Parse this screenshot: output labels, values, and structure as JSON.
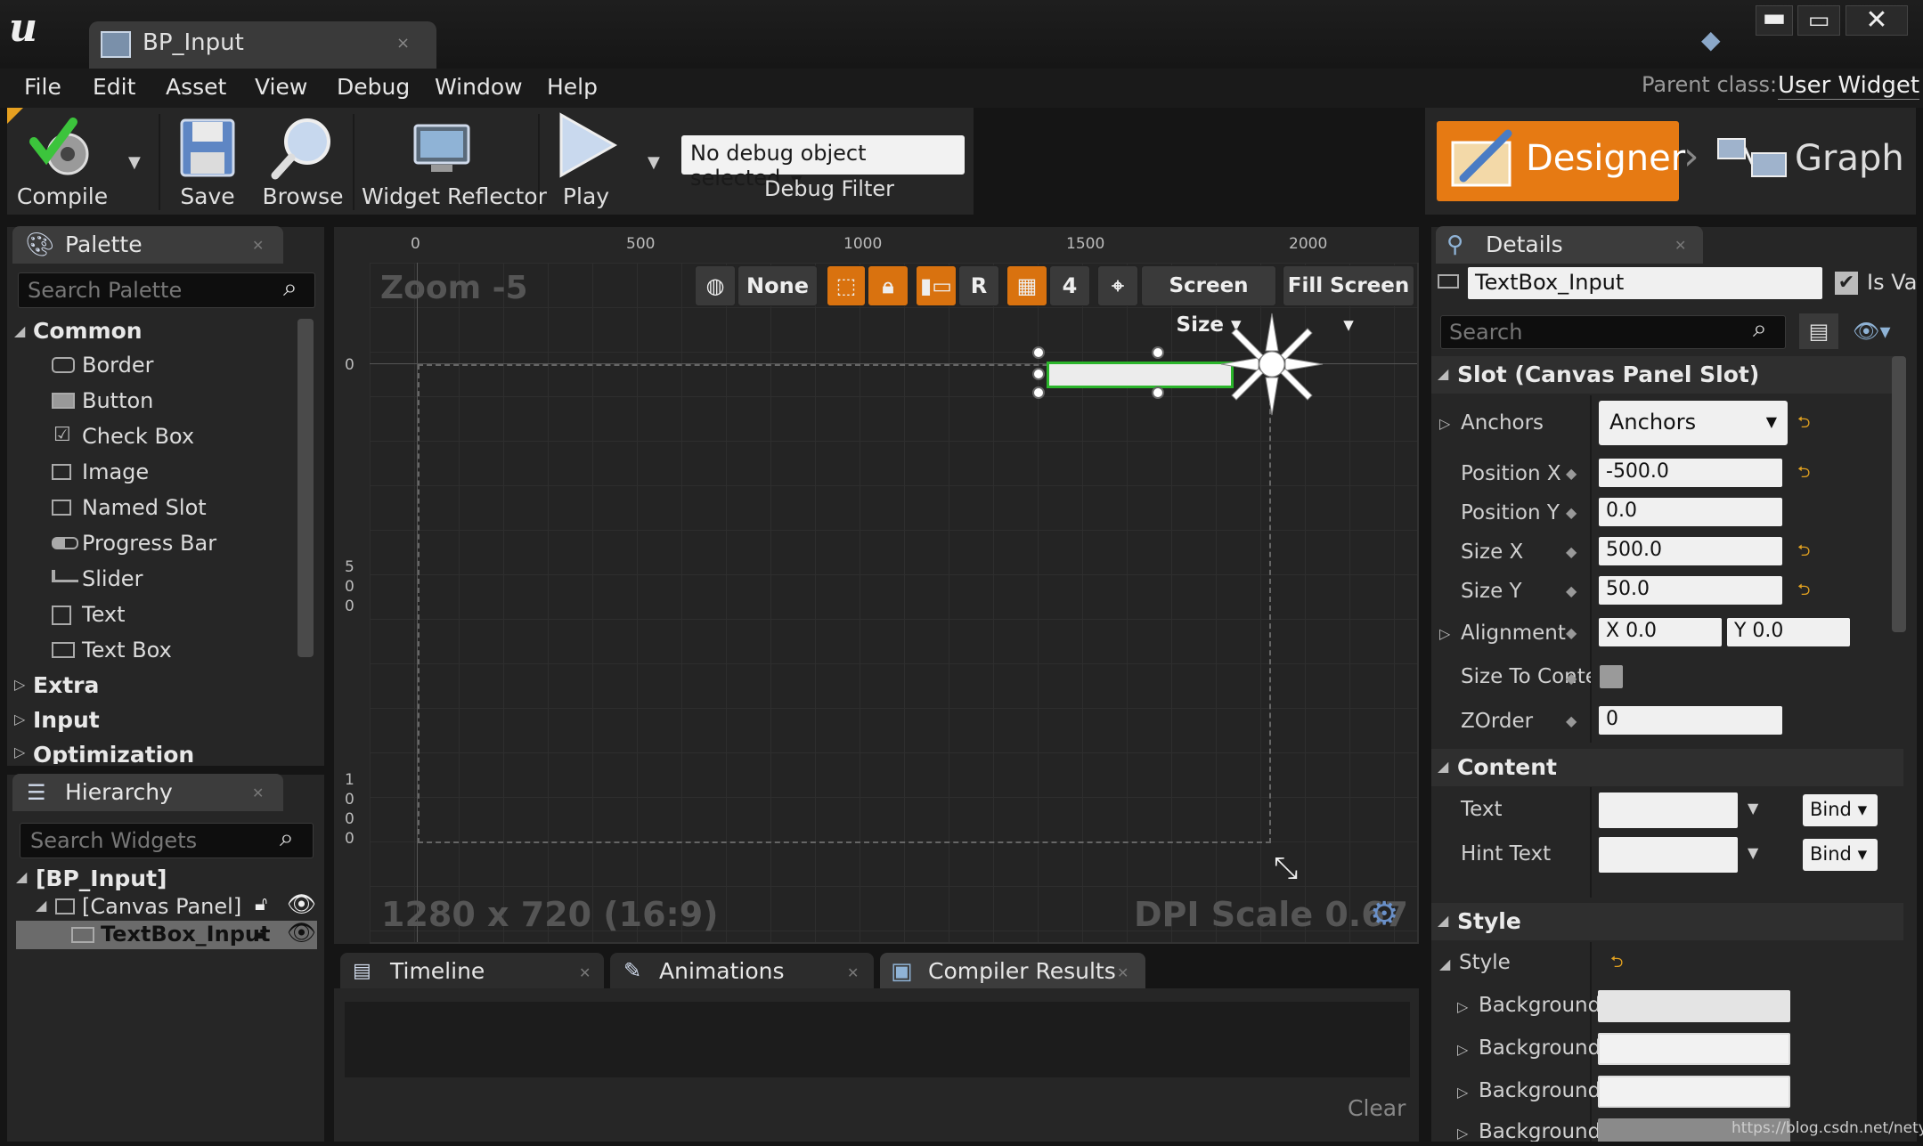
{
  "window": {
    "tab_title": "BP_Input",
    "tab_close": "×",
    "minimize": "▬",
    "maximize": "▭",
    "close": "✕"
  },
  "menu": {
    "items": [
      "File",
      "Edit",
      "Asset",
      "View",
      "Debug",
      "Window",
      "Help"
    ],
    "parent_class_label": "Parent class:",
    "parent_class_value": "User Widget"
  },
  "toolbar": {
    "compile": "Compile",
    "save": "Save",
    "browse": "Browse",
    "widget_reflector": "Widget Reflector",
    "play": "Play",
    "debug_object": "No debug object selected",
    "debug_filter": "Debug Filter"
  },
  "modes": {
    "designer": "Designer",
    "graph": "Graph"
  },
  "palette": {
    "tab": "Palette",
    "search_placeholder": "Search Palette",
    "categories": {
      "common": "Common",
      "extra": "Extra",
      "input": "Input",
      "optimization": "Optimization"
    },
    "items": [
      "Border",
      "Button",
      "Check Box",
      "Image",
      "Named Slot",
      "Progress Bar",
      "Slider",
      "Text",
      "Text Box"
    ]
  },
  "hierarchy": {
    "tab": "Hierarchy",
    "search_placeholder": "Search Widgets",
    "root": "[BP_Input]",
    "canvas": "[Canvas Panel]",
    "textbox": "TextBox_Input"
  },
  "viewport": {
    "zoom": "Zoom -5",
    "resolution": "1280 x 720 (16:9)",
    "dpi": "DPI Scale 0.67",
    "ruler_top": [
      "0",
      "500",
      "1000",
      "1500",
      "2000"
    ],
    "ruler_left_0": "0",
    "ruler_left_500": [
      "5",
      "0",
      "0"
    ],
    "ruler_left_1000": [
      "1",
      "0",
      "0",
      "0"
    ],
    "tool_none": "None",
    "tool_r": "R",
    "tool_grid": "4",
    "screen_size": "Screen Size",
    "fill_screen": "Fill Screen"
  },
  "bottom_tabs": {
    "timeline": "Timeline",
    "animations": "Animations",
    "compiler_results": "Compiler Results",
    "clear": "Clear"
  },
  "details": {
    "tab": "Details",
    "widget_name": "TextBox_Input",
    "is_variable": "Is Va",
    "search_placeholder": "Search",
    "slot_section": "Slot (Canvas Panel Slot)",
    "anchors_label": "Anchors",
    "anchors_value": "Anchors",
    "position_x_label": "Position X",
    "position_x": "-500.0",
    "position_y_label": "Position Y",
    "position_y": "0.0",
    "size_x_label": "Size X",
    "size_x": "500.0",
    "size_y_label": "Size Y",
    "size_y": "50.0",
    "alignment_label": "Alignment",
    "alignment_x": "X  0.0",
    "alignment_y": "Y  0.0",
    "size_to_content_label": "Size To Conte",
    "zorder_label": "ZOrder",
    "zorder": "0",
    "content_section": "Content",
    "text_label": "Text",
    "hint_text_label": "Hint Text",
    "bind": "Bind",
    "style_section": "Style",
    "style_label": "Style",
    "background_label": "Background"
  },
  "watermark": "https://blog.csdn.net/netyeaxi",
  "colors": {
    "accent_orange": "#e67a13",
    "selection_green": "#2bb52b",
    "panel_bg": "#262626"
  }
}
